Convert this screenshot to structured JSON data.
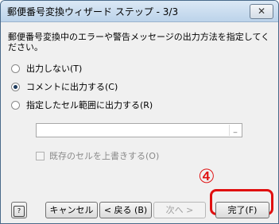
{
  "window": {
    "title": "郵便番号変換ウィザード ステップ - 3/3",
    "close_glyph": "✕"
  },
  "message": "郵便番号変換中のエラーや警告メッセージの出力方法を指定してください。",
  "options": [
    {
      "label": "出力しない(T)",
      "checked": false
    },
    {
      "label": "コメントに出力する(C)",
      "checked": true
    },
    {
      "label": "指定したセル範囲に出力する(R)",
      "checked": false
    }
  ],
  "range_input": {
    "value": "",
    "button_glyph": "_"
  },
  "overwrite_checkbox": {
    "label": "既存のセルを上書きする(O)",
    "checked": false,
    "enabled": false
  },
  "annotation": {
    "number": "④",
    "color": "#e01010"
  },
  "buttons": {
    "help_glyph": "?",
    "cancel": "キャンセル",
    "back": "< 戻る (B)",
    "next": "次へ >",
    "finish": "完了(F)"
  }
}
